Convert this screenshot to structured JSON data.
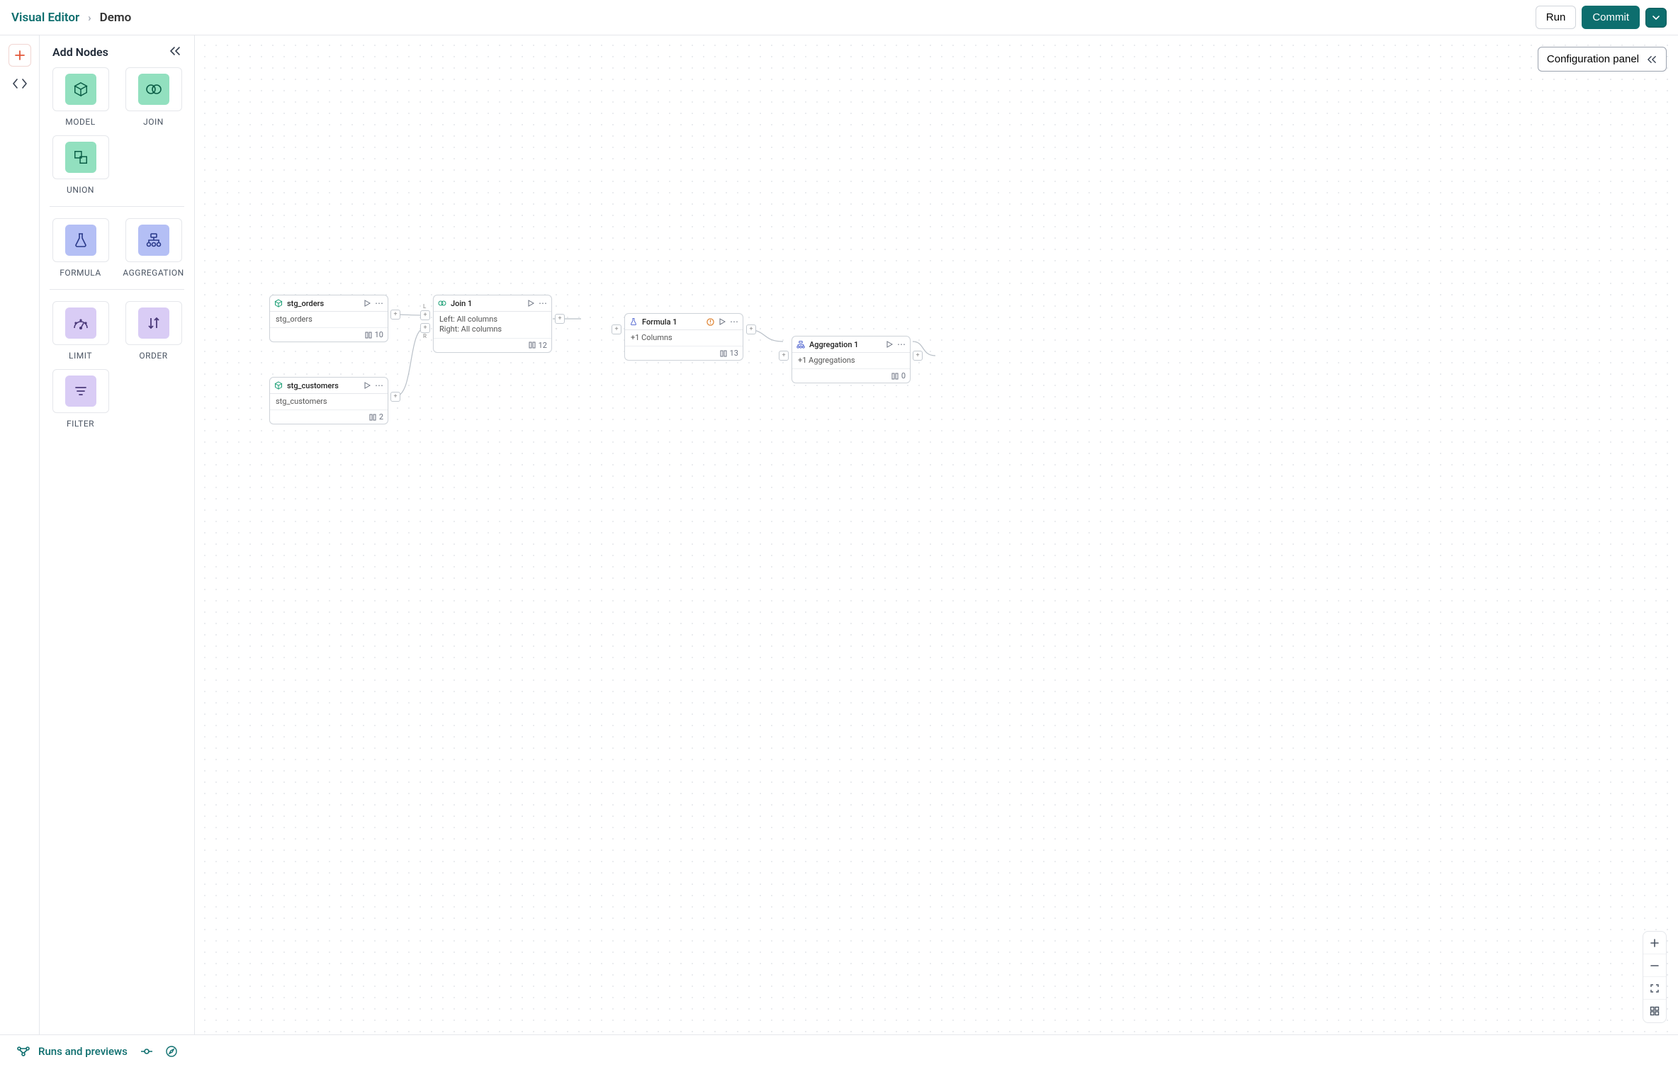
{
  "header": {
    "app_name": "Visual Editor",
    "page_name": "Demo",
    "run_label": "Run",
    "commit_label": "Commit"
  },
  "sidebar": {
    "title": "Add Nodes",
    "groups": [
      {
        "items": [
          {
            "key": "model",
            "label": "MODEL",
            "chip": "chip-green"
          },
          {
            "key": "join",
            "label": "JOIN",
            "chip": "chip-green"
          },
          {
            "key": "union",
            "label": "UNION",
            "chip": "chip-green"
          }
        ]
      },
      {
        "items": [
          {
            "key": "formula",
            "label": "FORMULA",
            "chip": "chip-blue"
          },
          {
            "key": "aggregation",
            "label": "AGGREGATION",
            "chip": "chip-blue"
          }
        ]
      },
      {
        "items": [
          {
            "key": "limit",
            "label": "LIMIT",
            "chip": "chip-purple"
          },
          {
            "key": "order",
            "label": "ORDER",
            "chip": "chip-purple"
          },
          {
            "key": "filter",
            "label": "FILTER",
            "chip": "chip-purple"
          }
        ]
      }
    ]
  },
  "config_panel": {
    "label": "Configuration panel"
  },
  "canvas": {
    "nodes": {
      "stg_orders": {
        "title": "stg_orders",
        "body": "stg_orders",
        "count": "10"
      },
      "stg_customers": {
        "title": "stg_customers",
        "body": "stg_customers",
        "count": "2"
      },
      "join1": {
        "title": "Join 1",
        "body_l": "Left: All columns",
        "body_r": "Right: All columns",
        "count": "12"
      },
      "formula1": {
        "title": "Formula 1",
        "body": "+1 Columns",
        "count": "13",
        "warning": true
      },
      "agg1": {
        "title": "Aggregation 1",
        "body": "+1 Aggregations",
        "count": "0"
      }
    }
  },
  "bottom": {
    "label": "Runs and previews"
  }
}
